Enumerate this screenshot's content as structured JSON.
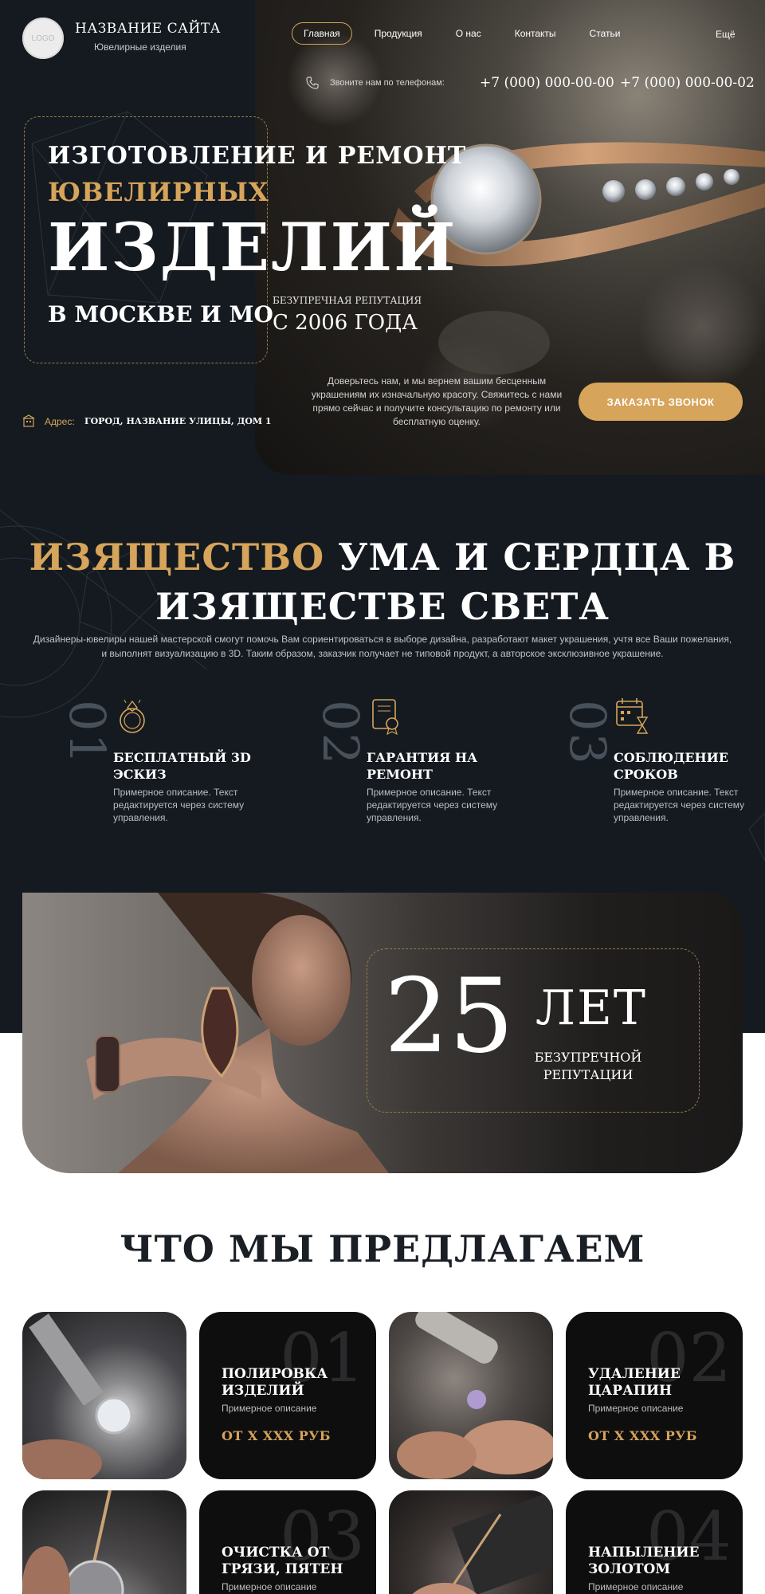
{
  "header": {
    "logo_text": "LOGO",
    "site_name": "НАЗВАНИЕ САЙТА",
    "site_subtitle": "Ювелирные изделия",
    "nav": [
      "Главная",
      "Продукция",
      "О нас",
      "Контакты",
      "Статьи"
    ],
    "nav_more": "Ещё",
    "phone_label": "Звоните нам по телефонам:",
    "phone1": "+7 (000) 000-00-00",
    "phone2": "+7 (000) 000-00-02"
  },
  "hero": {
    "line1": "ИЗГОТОВЛЕНИЕ И РЕМОНТ",
    "line2": "ЮВЕЛИРНЫХ",
    "line3": "ИЗДЕЛИЙ",
    "line4": "В МОСКВЕ И МО",
    "reputation_label": "БЕЗУПРЕЧНАЯ РЕПУТАЦИЯ",
    "reputation_year": "С 2006 ГОДА",
    "description": "Доверьтесь нам, и мы вернем вашим бесценным украшениям их изначальную красоту. Свяжитесь с нами прямо сейчас и получите консультацию по ремонту или бесплатную оценку.",
    "cta": "ЗАКАЗАТЬ ЗВОНОК",
    "address_label": "Адрес:",
    "address_value": "ГОРОД, НАЗВАНИЕ УЛИЦЫ, ДОМ 1"
  },
  "section2": {
    "title_gold": "ИЗЯЩЕСТВО",
    "title_rest": "УМА И СЕРДЦА В",
    "title_line2": "ИЗЯЩЕСТВЕ СВЕТА",
    "description": "Дизайнеры-ювелиры нашей мастерской смогут помочь Вам сориентироваться в выборе дизайна, разработают макет украшения, учтя все Ваши пожелания, и выполнят визуализацию в 3D. Таким образом, заказчик получает не типовой продукт, а авторское эксклюзивное украшение.",
    "features": [
      {
        "num": "01",
        "title": "БЕСПЛАТНЫЙ 3D ЭСКИЗ",
        "desc": "Примерное описание. Текст редактируется через систему управления.",
        "icon": "ring-icon"
      },
      {
        "num": "02",
        "title": "ГАРАНТИЯ НА РЕМОНТ",
        "desc": "Примерное описание. Текст редактируется через систему управления.",
        "icon": "certificate-icon"
      },
      {
        "num": "03",
        "title": "СОБЛЮДЕНИЕ СРОКОВ",
        "desc": "Примерное описание. Текст редактируется через систему управления.",
        "icon": "calendar-hourglass-icon"
      }
    ]
  },
  "banner": {
    "number": "25",
    "unit": "ЛЕТ",
    "caption": "БЕЗУПРЕЧНОЙ РЕПУТАЦИИ"
  },
  "services": {
    "title": "ЧТО МЫ ПРЕДЛАГАЕМ",
    "items": [
      {
        "num": "01",
        "title": "ПОЛИРОВКА ИЗДЕЛИЙ",
        "desc": "Примерное описание",
        "price": "ОТ Х ХХХ РУБ"
      },
      {
        "num": "02",
        "title": "УДАЛЕНИЕ ЦАРАПИН",
        "desc": "Примерное описание",
        "price": "ОТ Х ХХХ РУБ"
      },
      {
        "num": "03",
        "title": "ОЧИСТКА ОТ ГРЯЗИ, ПЯТЕН",
        "desc": "Примерное описание",
        "price": ""
      },
      {
        "num": "04",
        "title": "НАПЫЛЕНИЕ ЗОЛОТОМ",
        "desc": "Примерное описание",
        "price": ""
      }
    ]
  },
  "colors": {
    "background_dark": "#141a20",
    "accent_gold": "#d6a45a",
    "heading_dark": "#1a1f26"
  }
}
